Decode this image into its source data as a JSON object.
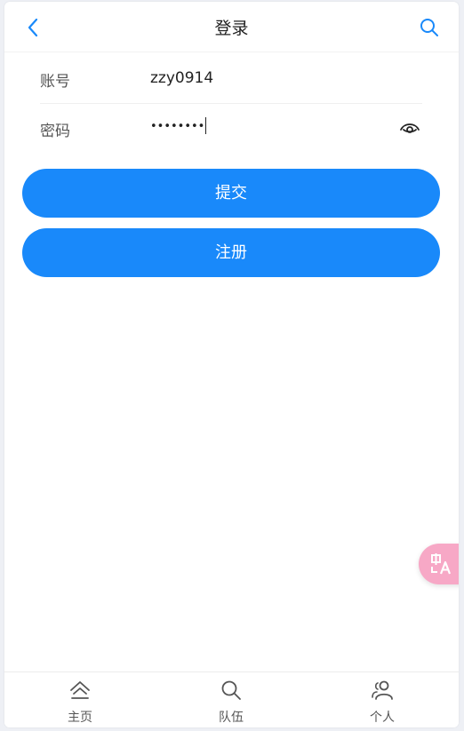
{
  "navbar": {
    "title": "登录",
    "back_icon": "chevron-left-icon",
    "search_icon": "search-icon",
    "accent_color": "#1989fa"
  },
  "form": {
    "account": {
      "label": "账号",
      "value": "zzy0914"
    },
    "password": {
      "label": "密码",
      "masked_value": "••••••••",
      "toggle_icon": "eye-icon"
    }
  },
  "buttons": {
    "submit_label": "提交",
    "register_label": "注册",
    "color": "#1989fa"
  },
  "floating": {
    "icon": "translate-icon",
    "color": "#f7a8c6"
  },
  "tabbar": {
    "tabs": [
      {
        "label": "主页",
        "icon": "home-icon"
      },
      {
        "label": "队伍",
        "icon": "search-icon"
      },
      {
        "label": "个人",
        "icon": "user-icon"
      }
    ]
  }
}
